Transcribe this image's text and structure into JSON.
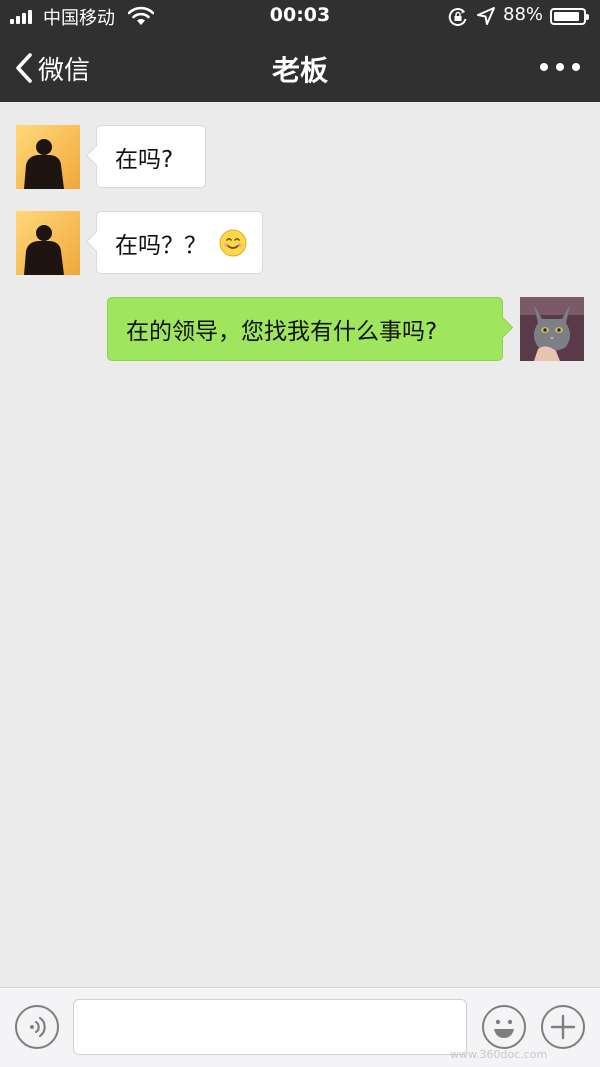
{
  "status_bar": {
    "carrier": "中国移动",
    "time": "00:03",
    "battery_percent": "88%",
    "battery_level": 0.88,
    "icons": [
      "signal-icon",
      "wifi-icon",
      "orientation-lock-icon",
      "location-arrow-icon",
      "battery-icon"
    ]
  },
  "nav": {
    "back_label": "微信",
    "title": "老板",
    "more_icon": "more-dots-icon"
  },
  "messages": [
    {
      "direction": "incoming",
      "sender": "boss",
      "text": "在吗?",
      "emoji": ""
    },
    {
      "direction": "incoming",
      "sender": "boss",
      "text": "在吗？？",
      "emoji": "smile-emoji-icon"
    },
    {
      "direction": "outgoing",
      "sender": "me",
      "text": "在的领导，您找我有什么事吗?",
      "emoji": ""
    }
  ],
  "input_bar": {
    "voice_icon": "voice-icon",
    "text_value": "",
    "emoji_icon": "emoji-icon",
    "plus_icon": "plus-icon"
  },
  "watermark": "www.360doc.com",
  "colors": {
    "nav_background": "#303030",
    "chat_background": "#ebebeb",
    "outgoing_bubble": "#9fe55e",
    "incoming_bubble": "#ffffff"
  }
}
